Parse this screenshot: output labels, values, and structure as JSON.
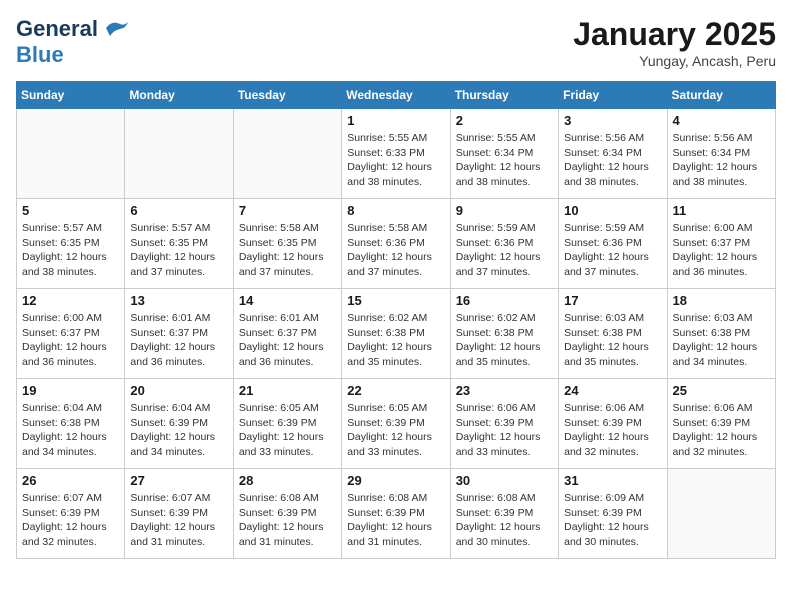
{
  "header": {
    "logo_line1": "General",
    "logo_line2": "Blue",
    "month_year": "January 2025",
    "location": "Yungay, Ancash, Peru"
  },
  "weekdays": [
    "Sunday",
    "Monday",
    "Tuesday",
    "Wednesday",
    "Thursday",
    "Friday",
    "Saturday"
  ],
  "weeks": [
    [
      {
        "day": "",
        "info": ""
      },
      {
        "day": "",
        "info": ""
      },
      {
        "day": "",
        "info": ""
      },
      {
        "day": "1",
        "info": "Sunrise: 5:55 AM\nSunset: 6:33 PM\nDaylight: 12 hours\nand 38 minutes."
      },
      {
        "day": "2",
        "info": "Sunrise: 5:55 AM\nSunset: 6:34 PM\nDaylight: 12 hours\nand 38 minutes."
      },
      {
        "day": "3",
        "info": "Sunrise: 5:56 AM\nSunset: 6:34 PM\nDaylight: 12 hours\nand 38 minutes."
      },
      {
        "day": "4",
        "info": "Sunrise: 5:56 AM\nSunset: 6:34 PM\nDaylight: 12 hours\nand 38 minutes."
      }
    ],
    [
      {
        "day": "5",
        "info": "Sunrise: 5:57 AM\nSunset: 6:35 PM\nDaylight: 12 hours\nand 38 minutes."
      },
      {
        "day": "6",
        "info": "Sunrise: 5:57 AM\nSunset: 6:35 PM\nDaylight: 12 hours\nand 37 minutes."
      },
      {
        "day": "7",
        "info": "Sunrise: 5:58 AM\nSunset: 6:35 PM\nDaylight: 12 hours\nand 37 minutes."
      },
      {
        "day": "8",
        "info": "Sunrise: 5:58 AM\nSunset: 6:36 PM\nDaylight: 12 hours\nand 37 minutes."
      },
      {
        "day": "9",
        "info": "Sunrise: 5:59 AM\nSunset: 6:36 PM\nDaylight: 12 hours\nand 37 minutes."
      },
      {
        "day": "10",
        "info": "Sunrise: 5:59 AM\nSunset: 6:36 PM\nDaylight: 12 hours\nand 37 minutes."
      },
      {
        "day": "11",
        "info": "Sunrise: 6:00 AM\nSunset: 6:37 PM\nDaylight: 12 hours\nand 36 minutes."
      }
    ],
    [
      {
        "day": "12",
        "info": "Sunrise: 6:00 AM\nSunset: 6:37 PM\nDaylight: 12 hours\nand 36 minutes."
      },
      {
        "day": "13",
        "info": "Sunrise: 6:01 AM\nSunset: 6:37 PM\nDaylight: 12 hours\nand 36 minutes."
      },
      {
        "day": "14",
        "info": "Sunrise: 6:01 AM\nSunset: 6:37 PM\nDaylight: 12 hours\nand 36 minutes."
      },
      {
        "day": "15",
        "info": "Sunrise: 6:02 AM\nSunset: 6:38 PM\nDaylight: 12 hours\nand 35 minutes."
      },
      {
        "day": "16",
        "info": "Sunrise: 6:02 AM\nSunset: 6:38 PM\nDaylight: 12 hours\nand 35 minutes."
      },
      {
        "day": "17",
        "info": "Sunrise: 6:03 AM\nSunset: 6:38 PM\nDaylight: 12 hours\nand 35 minutes."
      },
      {
        "day": "18",
        "info": "Sunrise: 6:03 AM\nSunset: 6:38 PM\nDaylight: 12 hours\nand 34 minutes."
      }
    ],
    [
      {
        "day": "19",
        "info": "Sunrise: 6:04 AM\nSunset: 6:38 PM\nDaylight: 12 hours\nand 34 minutes."
      },
      {
        "day": "20",
        "info": "Sunrise: 6:04 AM\nSunset: 6:39 PM\nDaylight: 12 hours\nand 34 minutes."
      },
      {
        "day": "21",
        "info": "Sunrise: 6:05 AM\nSunset: 6:39 PM\nDaylight: 12 hours\nand 33 minutes."
      },
      {
        "day": "22",
        "info": "Sunrise: 6:05 AM\nSunset: 6:39 PM\nDaylight: 12 hours\nand 33 minutes."
      },
      {
        "day": "23",
        "info": "Sunrise: 6:06 AM\nSunset: 6:39 PM\nDaylight: 12 hours\nand 33 minutes."
      },
      {
        "day": "24",
        "info": "Sunrise: 6:06 AM\nSunset: 6:39 PM\nDaylight: 12 hours\nand 32 minutes."
      },
      {
        "day": "25",
        "info": "Sunrise: 6:06 AM\nSunset: 6:39 PM\nDaylight: 12 hours\nand 32 minutes."
      }
    ],
    [
      {
        "day": "26",
        "info": "Sunrise: 6:07 AM\nSunset: 6:39 PM\nDaylight: 12 hours\nand 32 minutes."
      },
      {
        "day": "27",
        "info": "Sunrise: 6:07 AM\nSunset: 6:39 PM\nDaylight: 12 hours\nand 31 minutes."
      },
      {
        "day": "28",
        "info": "Sunrise: 6:08 AM\nSunset: 6:39 PM\nDaylight: 12 hours\nand 31 minutes."
      },
      {
        "day": "29",
        "info": "Sunrise: 6:08 AM\nSunset: 6:39 PM\nDaylight: 12 hours\nand 31 minutes."
      },
      {
        "day": "30",
        "info": "Sunrise: 6:08 AM\nSunset: 6:39 PM\nDaylight: 12 hours\nand 30 minutes."
      },
      {
        "day": "31",
        "info": "Sunrise: 6:09 AM\nSunset: 6:39 PM\nDaylight: 12 hours\nand 30 minutes."
      },
      {
        "day": "",
        "info": ""
      }
    ]
  ]
}
